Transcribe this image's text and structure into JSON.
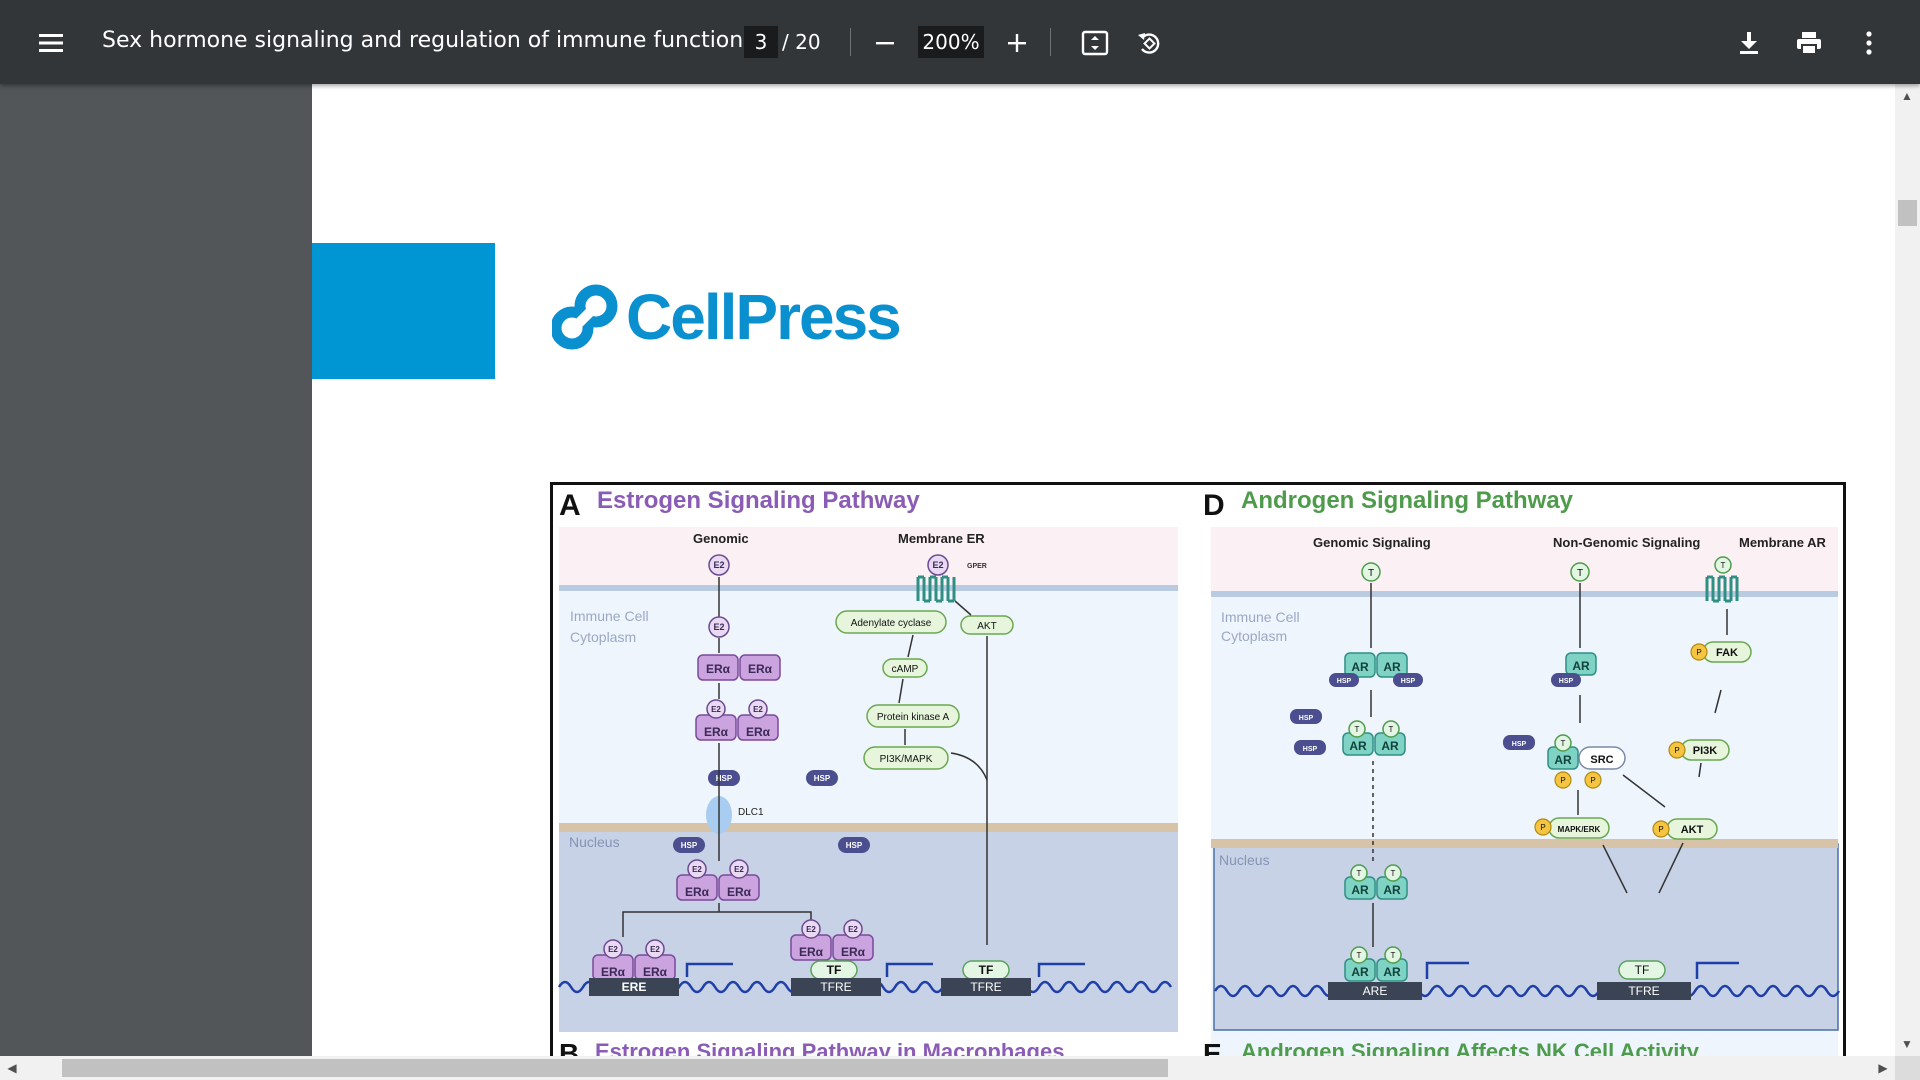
{
  "toolbar": {
    "title": "Sex hormone signaling and regulation of immune function",
    "current_page": "3",
    "total_pages": "/ 20",
    "zoom": "200%",
    "icons": [
      "menu-icon",
      "zoom-out-icon",
      "zoom-in-icon",
      "fit-page-icon",
      "rotate-icon",
      "download-icon",
      "print-icon",
      "more-options-icon"
    ]
  },
  "logo": {
    "text": "CellPress"
  },
  "figure": {
    "panel_a": {
      "letter": "A",
      "title": "Estrogen Signaling Pathway",
      "genomic": "Genomic",
      "membrane": "Membrane ER",
      "cytoplasm": [
        "Immune Cell",
        "Cytoplasm"
      ],
      "nucleus": "Nucleus",
      "e2": "E2",
      "gper": "GPER",
      "era": "ERα",
      "hsp": "HSP",
      "dlc1": "DLC1",
      "adenylate": "Adenylate cyclase",
      "camp": "cAMP",
      "pka": "Protein kinase A",
      "pi3k_mapk": "PI3K/MAPK",
      "akt": "AKT",
      "tf": "TF",
      "ere": "ERE",
      "tfre": "TFRE"
    },
    "panel_b": {
      "letter": "B",
      "title": "Estrogen Signaling Pathway in Macrophages"
    },
    "panel_d": {
      "letter": "D",
      "title": "Androgen Signaling Pathway",
      "genomic": "Genomic Signaling",
      "nongenomic": "Non-Genomic Signaling",
      "membrane": "Membrane AR",
      "cytoplasm": [
        "Immune Cell",
        "Cytoplasm"
      ],
      "nucleus": "Nucleus",
      "t": "T",
      "ar": "AR",
      "hsp": "HSP",
      "p": "P",
      "fak": "FAK",
      "src": "SRC",
      "pi3k": "PI3K",
      "mapk_erk": "MAPK/ERK",
      "akt": "AKT",
      "tf": "TF",
      "are": "ARE",
      "tfre": "TFRE"
    },
    "panel_e": {
      "letter": "E",
      "title": "Androgen Signaling Affects NK Cell Activity"
    }
  },
  "colors": {
    "toolbar": "#323639",
    "estrogen_purple": "#8a5cb5",
    "androgen_green": "#4e9c4b",
    "cellpress_blue": "#0095d3",
    "receptor_teal": "#5cc7b5"
  }
}
